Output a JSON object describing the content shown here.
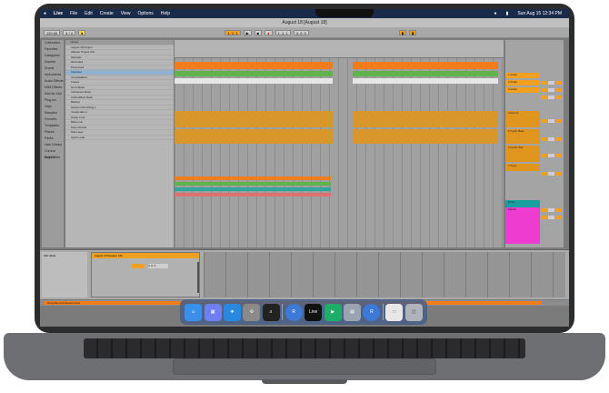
{
  "menubar": {
    "apple": "",
    "items": [
      "Live",
      "File",
      "Edit",
      "Create",
      "View",
      "Options",
      "Help"
    ],
    "clock": "Sun Aug 15 12:34 PM"
  },
  "window": {
    "title": "August 18 [August 18]"
  },
  "transport": {
    "tempo": "120.00",
    "signature": "4 / 4",
    "position": "1. 1. 1",
    "loop_start": "1. 1. 1",
    "loop_length": "4. 0. 0"
  },
  "browser": {
    "places": [
      "Collections",
      "Favorites",
      "Categories",
      "Sounds",
      "Drums",
      "Instruments",
      "Audio Effects",
      "MIDI Effects",
      "Max for Live",
      "Plug-Ins",
      "Clips",
      "Samples",
      "Grooves",
      "Templates",
      "Places",
      "Packs",
      "User Library",
      "Current Project",
      "Add Folder"
    ],
    "tree_header": "Name",
    "tree": [
      "August 18 Project",
      "Ableton Project Info",
      "Samples",
      "Recorded",
      "Processed",
      "Imported",
      "Consolidated",
      "Freeze",
      "Drum Rack",
      "Instrument Rack",
      "Audio Effect Rack",
      "Backup",
      "Session Recording 1",
      "Vocals take 2",
      "Guitar Loop",
      "Bass Line",
      "Keys Chords",
      "Pad Layer",
      "Synth Lead"
    ]
  },
  "tracks": [
    {
      "name": "1 Audio",
      "color": "#f0a020"
    },
    {
      "name": "2 Audio",
      "color": "#f0a020"
    },
    {
      "name": "3 Audio",
      "color": "#f0a020"
    },
    {
      "name": "4 Drums",
      "color": "#e0951f"
    },
    {
      "name": "5 Synth Bass",
      "color": "#e0951f"
    },
    {
      "name": "6 Synth Pad",
      "color": "#e0951f"
    },
    {
      "name": "7 Keys",
      "color": "#e0951f"
    },
    {
      "name": "8 Vox",
      "color": "#18a0a0"
    },
    {
      "name": "Master",
      "color": "#ee3bd0"
    }
  ],
  "detail": {
    "info_title": "Info View",
    "device_title": "August 18 Session Clip",
    "clip_length": "4. 0. 0"
  },
  "status": {
    "message": "Drag files and devices here"
  },
  "dock": {
    "apps": [
      "Finder",
      "Launchpad",
      "Safari",
      "System Preferences",
      "Piano",
      "Rosetta",
      "Live",
      "Messages",
      "Preview",
      "Rosetta",
      "Document",
      "Trash"
    ]
  },
  "colors": {
    "orange_clip": "#f07c1c",
    "amber_clip": "#d9962a",
    "green_clip": "#5fb34a",
    "teal_clip": "#2fa59c",
    "magenta_clip": "#ee3bd0"
  }
}
